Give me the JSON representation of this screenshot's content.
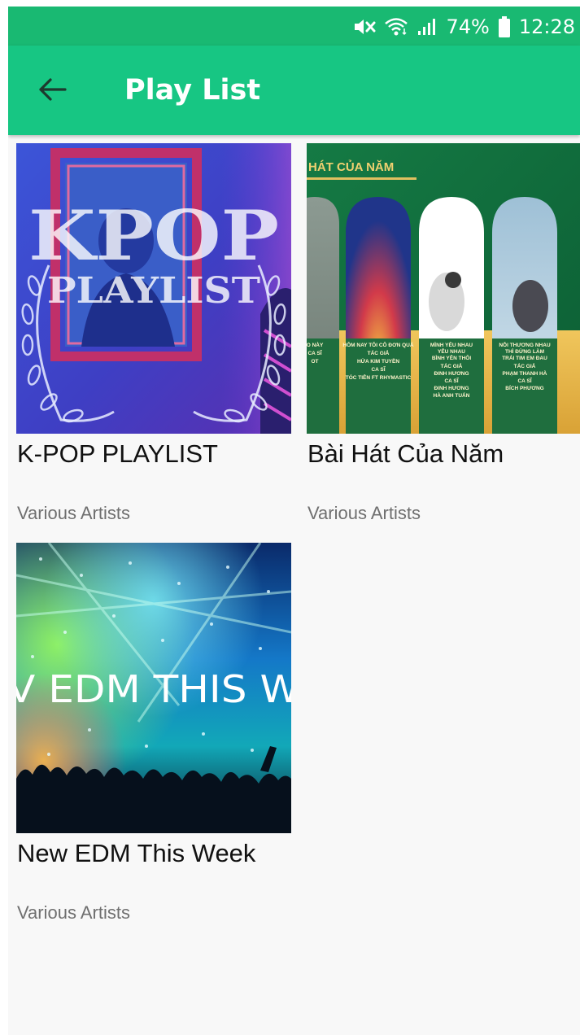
{
  "status_bar": {
    "battery_percent": "74%",
    "time": "12:28",
    "icons": [
      "mute-icon",
      "wifi-icon",
      "signal-icon",
      "battery-icon"
    ]
  },
  "app_bar": {
    "title": "Play List",
    "back_icon": "arrow-left-icon"
  },
  "colors": {
    "status_bar": "#19b972",
    "app_bar": "#17c683",
    "background": "#f8f8f8",
    "title_text": "#111111",
    "subtitle_text": "#6f6f6f"
  },
  "playlists": [
    {
      "title": "K-POP PLAYLIST",
      "artist": "Various Artists",
      "art": {
        "big": "KPOP",
        "small": "PLAYLIST"
      }
    },
    {
      "title": "Bài Hát Của Năm",
      "artist": "Various Artists",
      "art": {
        "header": "HÁT CỦA NĂM",
        "panels": [
          {
            "lines": [
              "O NÀY",
              "CA SĨ",
              "OT"
            ]
          },
          {
            "lines": [
              "HÔM NAY TÔI CÔ ĐƠN QUÁ",
              "TÁC GIẢ",
              "HỨA KIM TUYỀN",
              "CA SĨ",
              "TÓC TIÊN FT RHYMASTIC"
            ]
          },
          {
            "lines": [
              "MÌNH YÊU NHAU",
              "YÊU NHAU",
              "BÌNH YÊN THÔI",
              "TÁC GIẢ",
              "ĐINH HƯƠNG",
              "CA SĨ",
              "ĐINH HƯƠNG",
              "HÀ ANH TUẤN"
            ]
          },
          {
            "lines": [
              "NỖI THƯƠNG NHAU",
              "THÌ ĐỪNG LÀM",
              "TRÁI TIM EM ĐAU",
              "TÁC GIẢ",
              "PHẠM THANH HÀ",
              "CA SĨ",
              "BÍCH PHƯƠNG"
            ]
          }
        ]
      }
    },
    {
      "title": "New EDM This Week",
      "artist": "Various Artists",
      "art": {
        "banner": "V EDM THIS W"
      }
    }
  ]
}
